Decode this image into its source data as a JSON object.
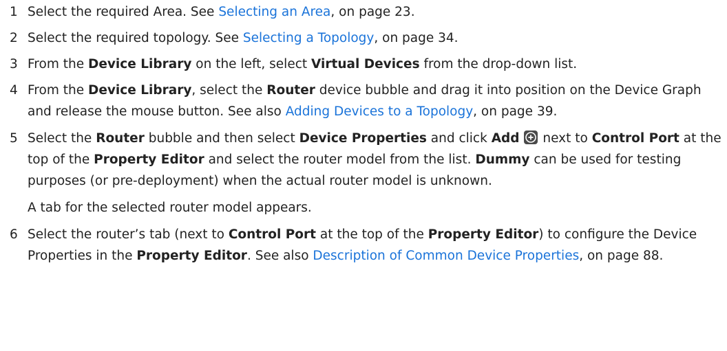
{
  "steps": [
    {
      "num": "1",
      "t1": "Select the required Area. See ",
      "link": "Selecting an Area",
      "t2": ", on page 23."
    },
    {
      "num": "2",
      "t1": "Select the required topology. See ",
      "link": "Selecting a Topology",
      "t2": ", on page 34."
    },
    {
      "num": "3",
      "t1": "From the ",
      "b1": "Device Library",
      "t2": " on the left, select ",
      "b2": "Virtual Devices",
      "t3": " from the drop-down list."
    },
    {
      "num": "4",
      "t1": "From the ",
      "b1": "Device Library",
      "t2": ", select the ",
      "b2": "Router",
      "t3": " device bubble and drag it into position on the Device Graph and release the mouse button. See also ",
      "link": "Adding Devices to a Topology",
      "t4": ", on page 39."
    },
    {
      "num": "5",
      "t1": "Select the ",
      "b1": "Router",
      "t2": " bubble and then select ",
      "b2": "Device Properties",
      "t3": " and click ",
      "b3": "Add",
      "t4": " next to ",
      "b4": "Control Port",
      "t5": " at the top of the ",
      "b5": "Property Editor",
      "t6": " and select the router model from the list. ",
      "b6": "Dummy",
      "t7": " can be used for testing purposes (or pre-deployment) when the actual router model is unknown.",
      "note": "A tab for the selected router model appears."
    },
    {
      "num": "6",
      "t1": "Select the router’s tab (next to ",
      "b1": "Control Port",
      "t2": " at the top of the ",
      "b2": "Property Editor",
      "t3": ") to configure the Device Properties in the ",
      "b3": "Property Editor",
      "t4": ". See also ",
      "link": "Description of Common Device Properties",
      "t5": ", on page 88."
    }
  ],
  "icons": {
    "add": "add-circle-icon"
  }
}
